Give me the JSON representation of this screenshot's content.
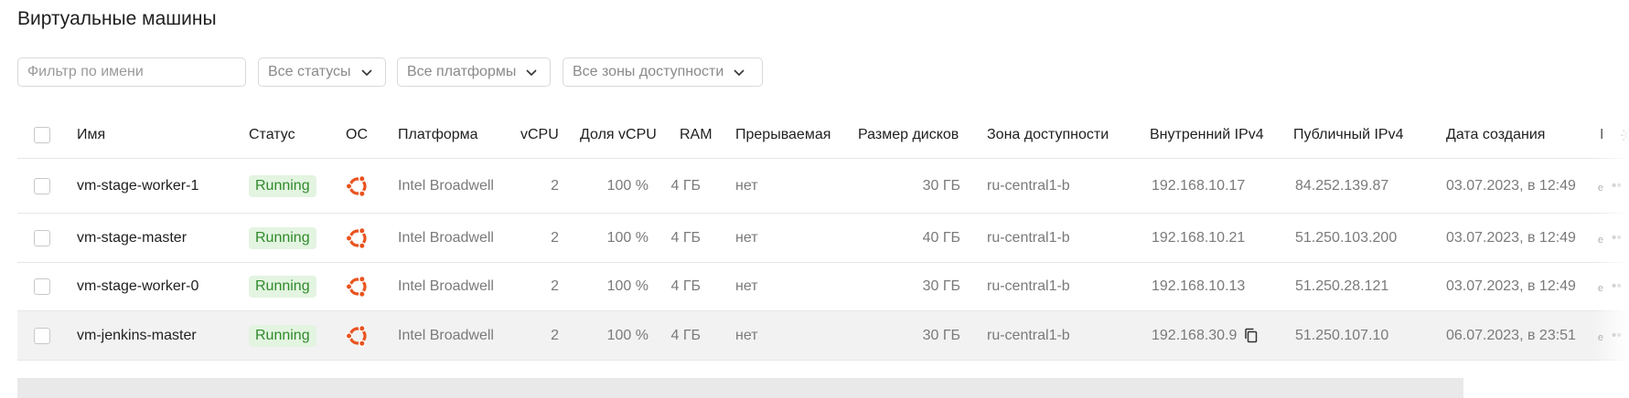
{
  "page": {
    "title": "Виртуальные машины"
  },
  "filters": {
    "name_placeholder": "Фильтр по имени",
    "status": "Все статусы",
    "platform": "Все платформы",
    "zone": "Все зоны доступности"
  },
  "table": {
    "columns": {
      "name": "Имя",
      "status": "Статус",
      "os": "ОС",
      "platform": "Платформа",
      "vcpu": "vCPU",
      "cpu_share": "Доля vCPU",
      "ram": "RAM",
      "preemptible": "Прерываемая",
      "disk_size": "Размер дисков",
      "zone": "Зона доступности",
      "internal_ip": "Внутренний IPv4",
      "public_ip": "Публичный IPv4",
      "created": "Дата создания",
      "extra": "I"
    },
    "rows": [
      {
        "name": "vm-stage-worker-1",
        "status": "Running",
        "os_icon": "ubuntu-icon",
        "platform": "Intel Broadwell",
        "vcpu": "2",
        "cpu_share": "100 %",
        "ram": "4 ГБ",
        "preemptible": "нет",
        "disk_size": "30 ГБ",
        "zone": "ru-central1-b",
        "internal_ip": "192.168.10.17",
        "public_ip": "84.252.139.87",
        "created": "03.07.2023, в 12:49"
      },
      {
        "name": "vm-stage-master",
        "status": "Running",
        "os_icon": "ubuntu-icon",
        "platform": "Intel Broadwell",
        "vcpu": "2",
        "cpu_share": "100 %",
        "ram": "4 ГБ",
        "preemptible": "нет",
        "disk_size": "40 ГБ",
        "zone": "ru-central1-b",
        "internal_ip": "192.168.10.21",
        "public_ip": "51.250.103.200",
        "created": "03.07.2023, в 12:49"
      },
      {
        "name": "vm-stage-worker-0",
        "status": "Running",
        "os_icon": "ubuntu-icon",
        "platform": "Intel Broadwell",
        "vcpu": "2",
        "cpu_share": "100 %",
        "ram": "4 ГБ",
        "preemptible": "нет",
        "disk_size": "30 ГБ",
        "zone": "ru-central1-b",
        "internal_ip": "192.168.10.13",
        "public_ip": "51.250.28.121",
        "created": "03.07.2023, в 12:49"
      },
      {
        "name": "vm-jenkins-master",
        "status": "Running",
        "os_icon": "ubuntu-icon",
        "platform": "Intel Broadwell",
        "vcpu": "2",
        "cpu_share": "100 %",
        "ram": "4 ГБ",
        "preemptible": "нет",
        "disk_size": "30 ГБ",
        "zone": "ru-central1-b",
        "internal_ip": "192.168.30.9",
        "public_ip": "51.250.107.10",
        "created": "06.07.2023, в 23:51"
      }
    ]
  },
  "colors": {
    "running_bg": "#e3f4e1",
    "running_text": "#2f8a2a",
    "ubuntu": "#e95420"
  }
}
